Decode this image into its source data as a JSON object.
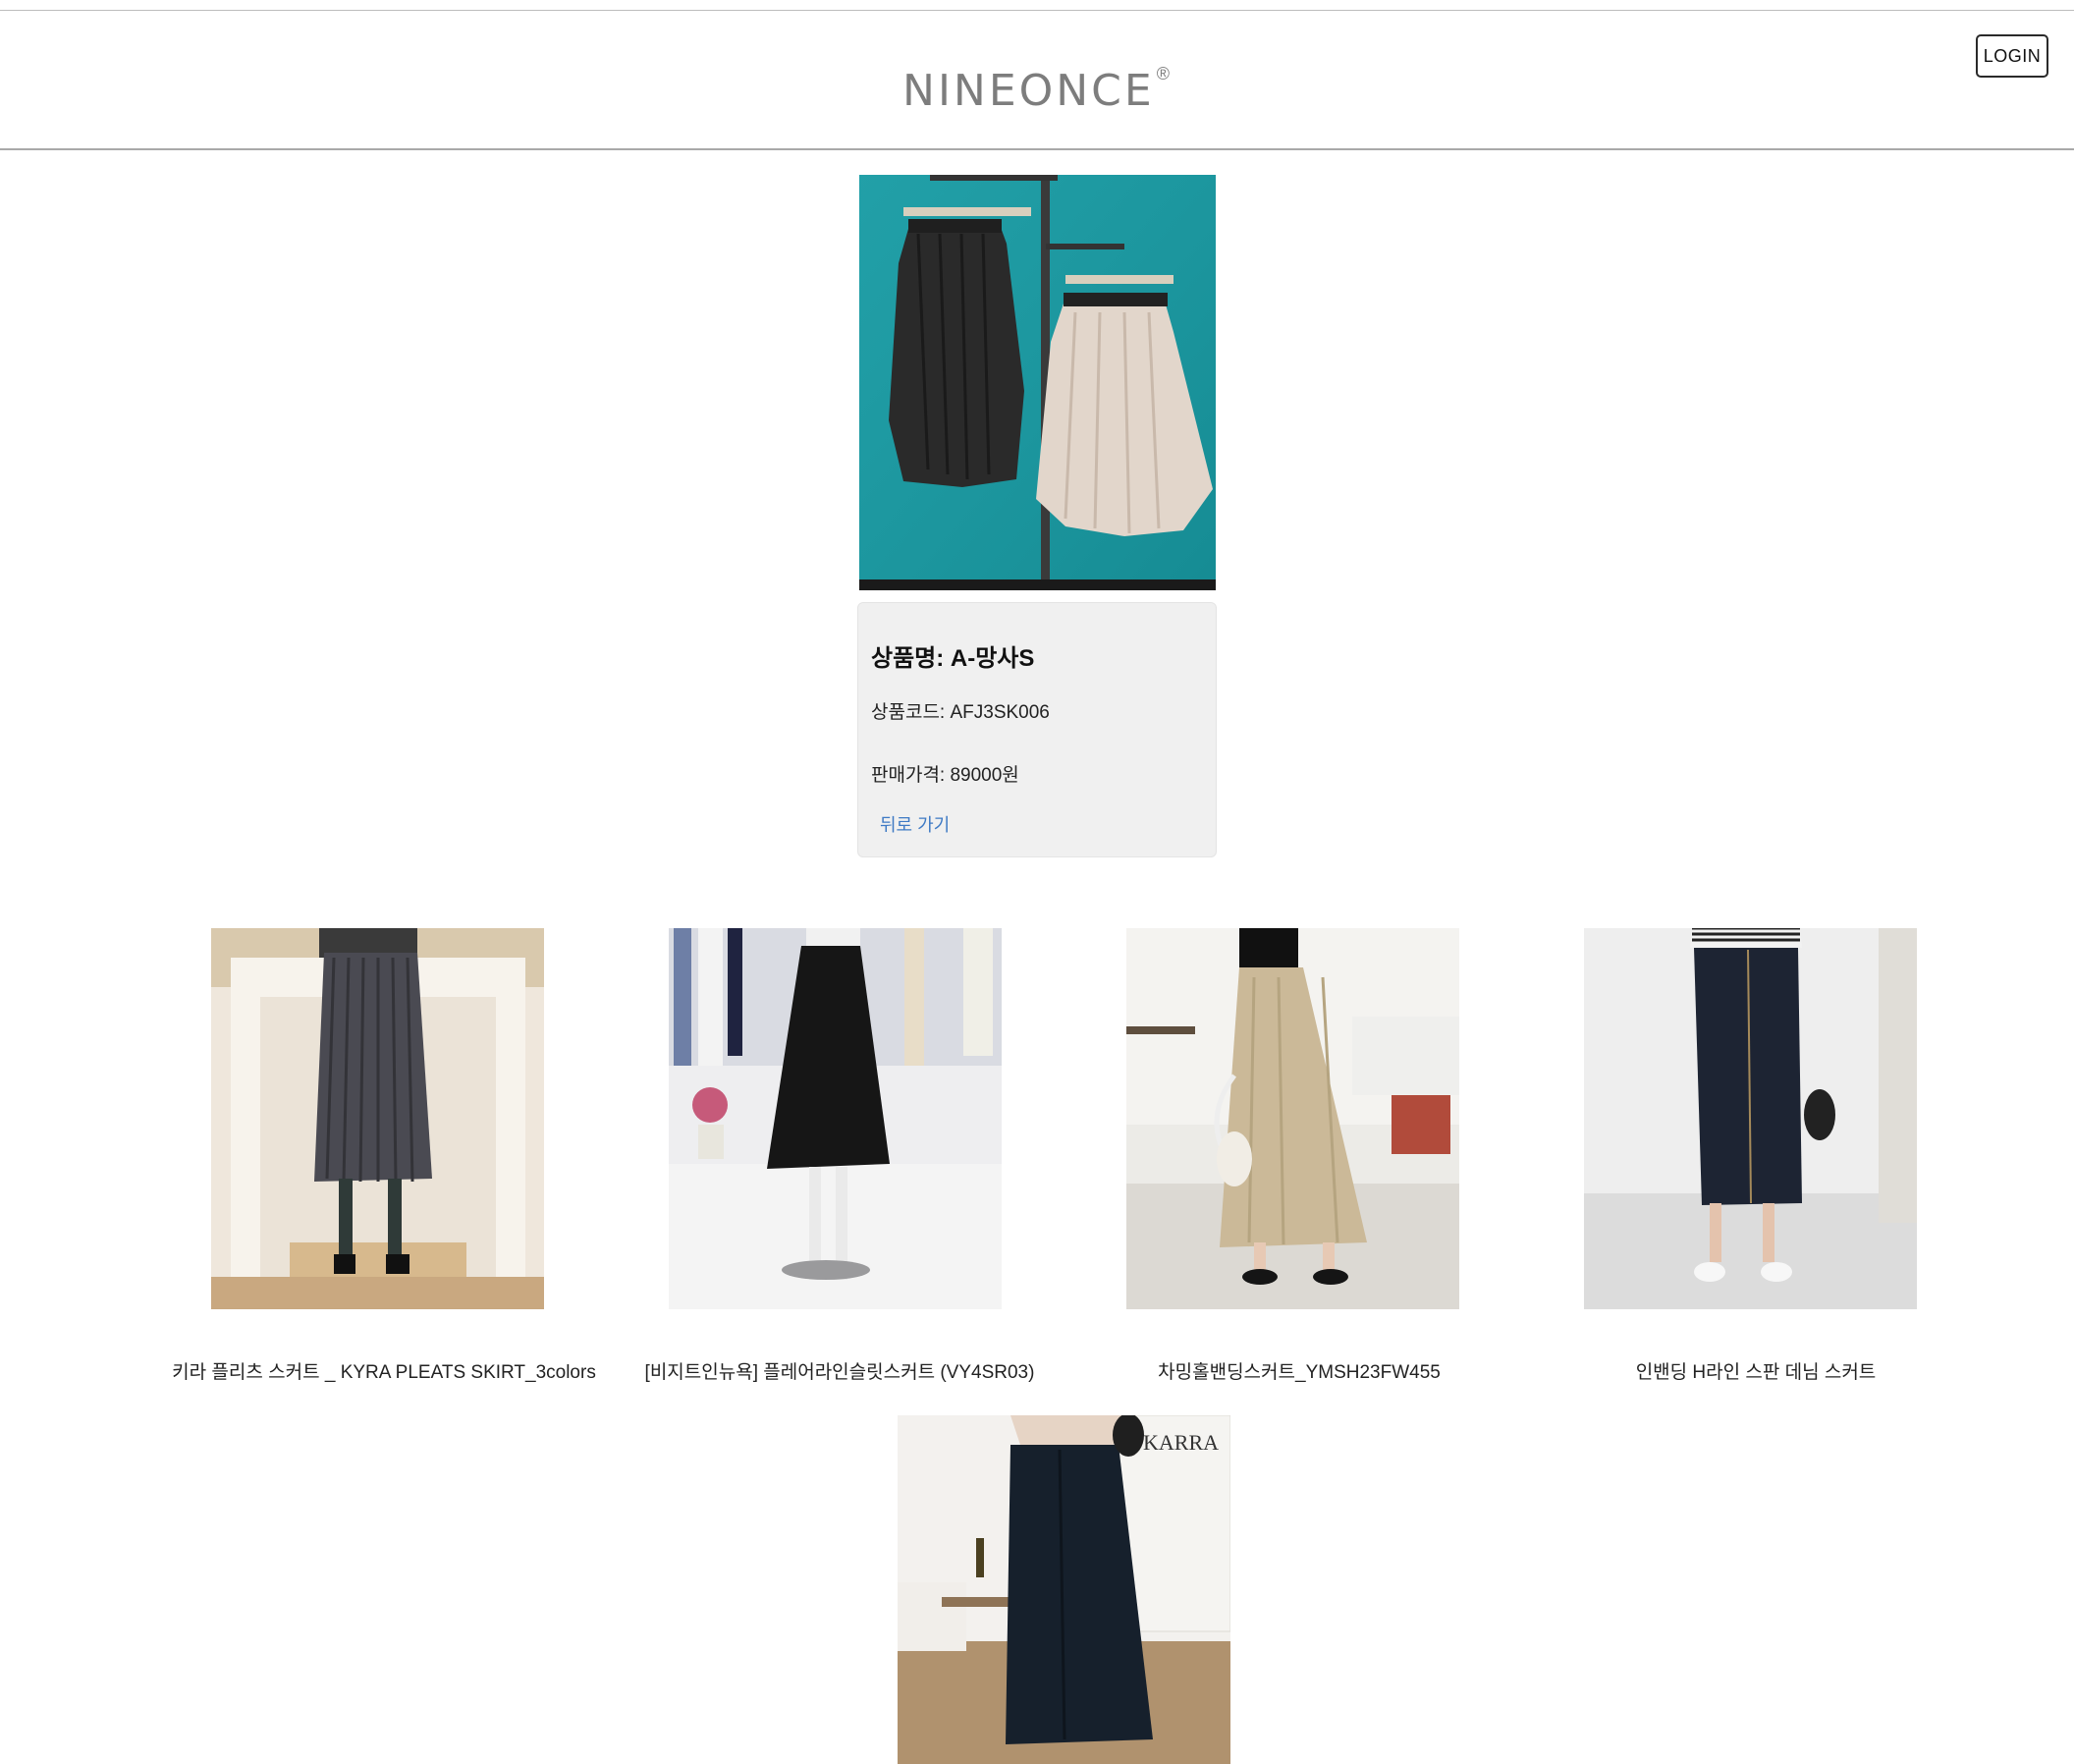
{
  "header": {
    "logo_text": "NINEONCE",
    "logo_mark": "®",
    "login_label": "LOGIN"
  },
  "product": {
    "name_label": "상품명: A-망사S",
    "code_label": "상품코드: AFJ3SK006",
    "price_label": "판매가격: 89000원",
    "back_label": "뒤로 가기",
    "image_desc": "two skirts on hangers"
  },
  "related": [
    {
      "title": "키라 플리츠 스커트 _ KYRA PLEATS SKIRT_3colors"
    },
    {
      "title": "[비지트인뉴욕] 플레어라인슬릿스커트 (VY4SR03)"
    },
    {
      "title": "차밍홀밴딩스커트_YMSH23FW455"
    },
    {
      "title": "인밴딩 H라인 스판 데님 스커트"
    },
    {
      "title": "",
      "image_text": "KARRA"
    }
  ],
  "colors": {
    "teal": "#1c9aa2",
    "link": "#3d79c4",
    "card_bg": "#f0f0f0"
  }
}
